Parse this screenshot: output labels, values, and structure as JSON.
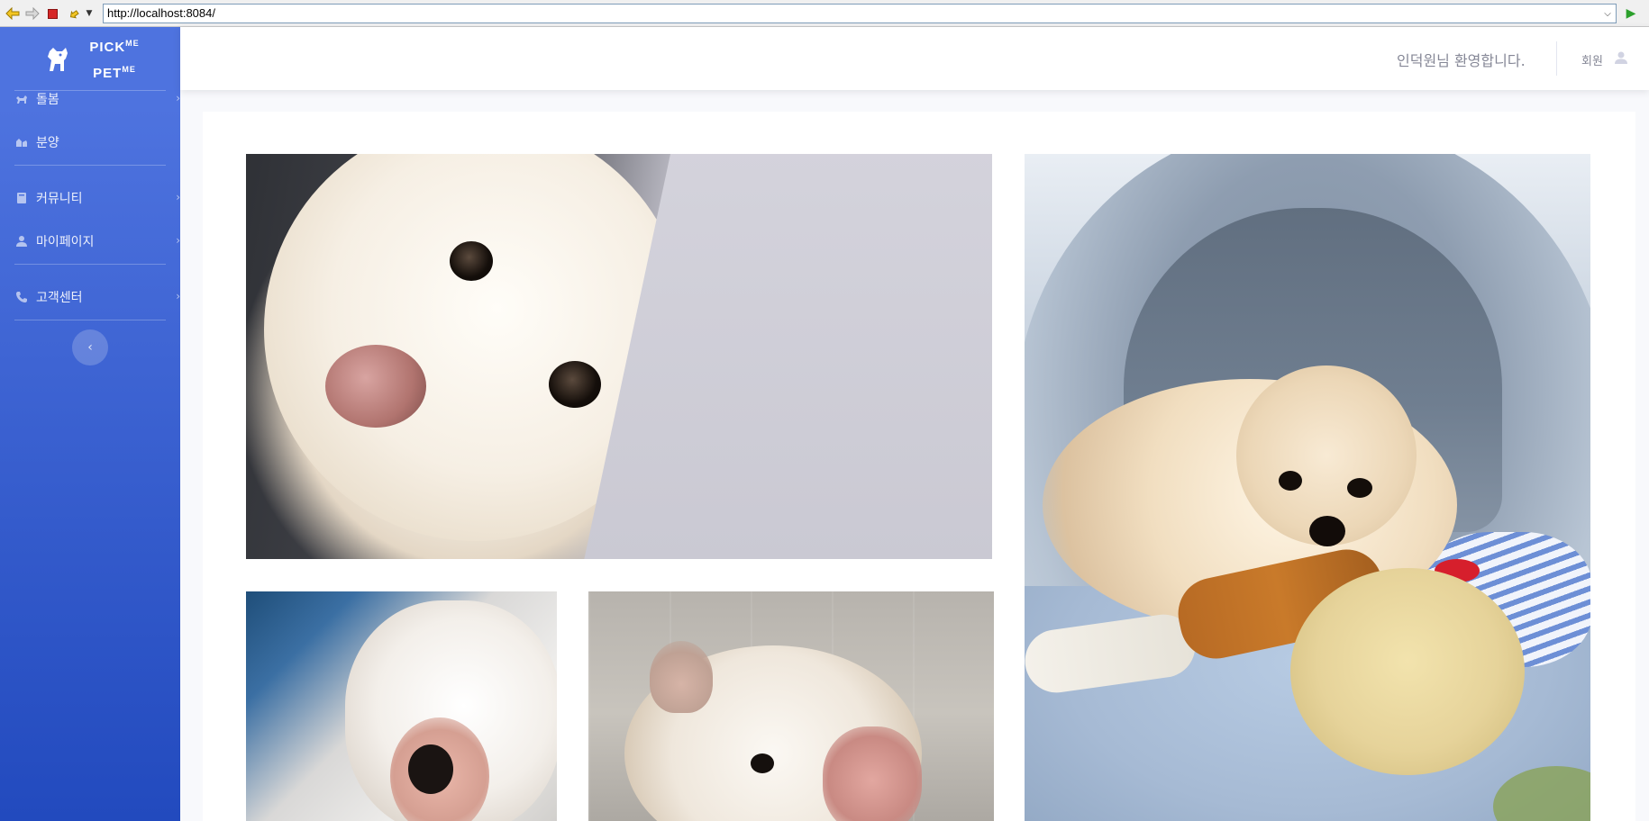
{
  "browser": {
    "url": "http://localhost:8084/"
  },
  "brand": {
    "line1": "PICK",
    "line1_sup": "ME",
    "line2": "PET",
    "line2_sup": "ME"
  },
  "sidebar": {
    "items": [
      {
        "label": "돌봄",
        "icon": "dog-icon",
        "has_chevron": true
      },
      {
        "label": "분양",
        "icon": "dog-house-icon",
        "has_chevron": false
      },
      {
        "label": "커뮤니티",
        "icon": "book-icon",
        "has_chevron": true
      },
      {
        "label": "마이페이지",
        "icon": "user-icon",
        "has_chevron": true
      },
      {
        "label": "고객센터",
        "icon": "phone-icon",
        "has_chevron": true
      }
    ],
    "toggle_icon": "chevron-left-icon"
  },
  "topbar": {
    "welcome": "인덕원님 환영합니다.",
    "member_label": "회원"
  },
  "gallery": {
    "photos": [
      {
        "subject": "white dog close-up peeking behind panel"
      },
      {
        "subject": "white fluffy dog lying upside down"
      },
      {
        "subject": "white fluffy dog held by hand"
      },
      {
        "subject": "cream puppy lying in round bed with toys"
      }
    ]
  },
  "colors": {
    "sidebar_top": "#4e73df",
    "sidebar_bottom": "#224abe",
    "text_muted": "#858796"
  }
}
